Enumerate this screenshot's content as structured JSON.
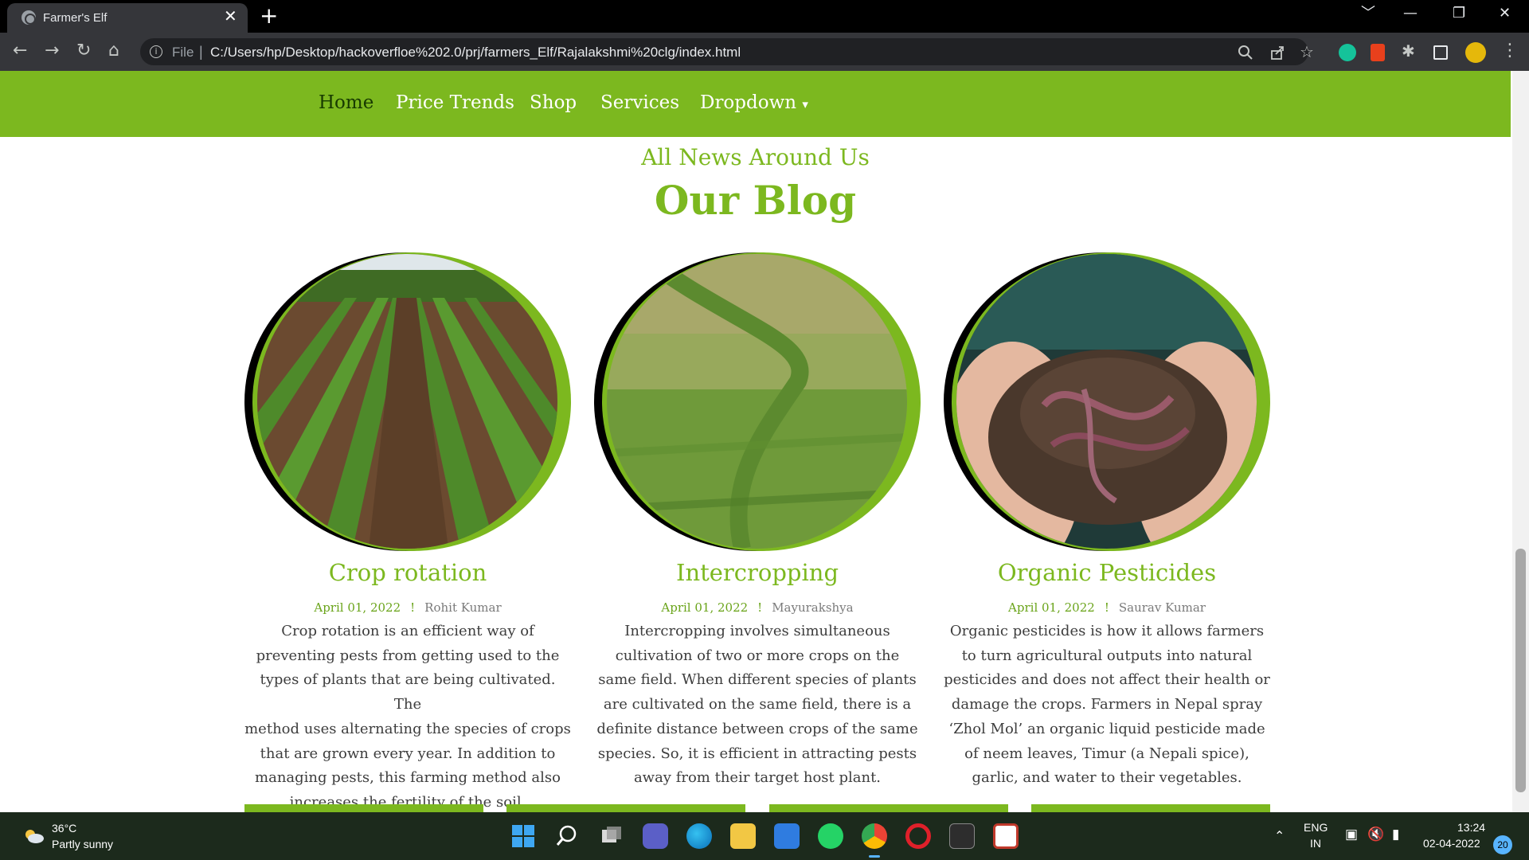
{
  "browser": {
    "tab_title": "Farmer's Elf",
    "close_tab": "✕",
    "new_tab": "+",
    "url_scheme": "File",
    "url": "C:/Users/hp/Desktop/hackoverfloe%202.0/prj/farmers_Elf/Rajalakshmi%20clg/index.html",
    "window_controls": [
      "﹀",
      "—",
      "❐",
      "✕"
    ]
  },
  "nav": {
    "items": [
      "Home",
      "Price Trends",
      "Shop",
      "Services",
      "Dropdown"
    ],
    "dropdown_caret": "▾"
  },
  "section": {
    "eyebrow": "All News Around Us",
    "title": "Our Blog"
  },
  "posts": [
    {
      "title": "Crop rotation",
      "date": "April 01, 2022",
      "author": "Rohit Kumar",
      "lines": [
        "Crop rotation is an efficient way of",
        "preventing pests from getting used to the",
        "types of plants that are being cultivated. The",
        "method uses alternating the species of crops",
        "that are grown every year. In addition to",
        "managing pests, this farming method also",
        "increases the fertility of the soil."
      ]
    },
    {
      "title": "Intercropping",
      "date": "April 01, 2022",
      "author": "Mayurakshya",
      "lines": [
        "Intercropping involves simultaneous",
        "cultivation of two or more crops on the",
        "same field. When different species of plants",
        "are cultivated on the same field, there is a",
        "definite distance between crops of the same",
        "species. So, it is efficient in attracting pests",
        "away from their target host plant."
      ]
    },
    {
      "title": "Organic Pesticides",
      "date": "April 01, 2022",
      "author": "Saurav Kumar",
      "lines": [
        "Organic pesticides is how it allows farmers",
        "to turn agricultural outputs into natural",
        "pesticides and does not affect their health or",
        "damage the crops. Farmers in Nepal spray",
        "‘Zhol Mol’ an organic liquid pesticide made",
        "of neem leaves, Timur (a Nepali spice),",
        "garlic, and water to their vegetables."
      ]
    }
  ],
  "post_separator": "!",
  "taskbar": {
    "temperature": "36°C",
    "weather": "Partly sunny",
    "language": "ENG",
    "region": "IN",
    "time": "13:24",
    "date": "02-04-2022",
    "notifications": "20"
  },
  "colors": {
    "brand_green": "#7cb81f",
    "nav_active": "#173a00",
    "chrome_dark": "#35363a"
  }
}
